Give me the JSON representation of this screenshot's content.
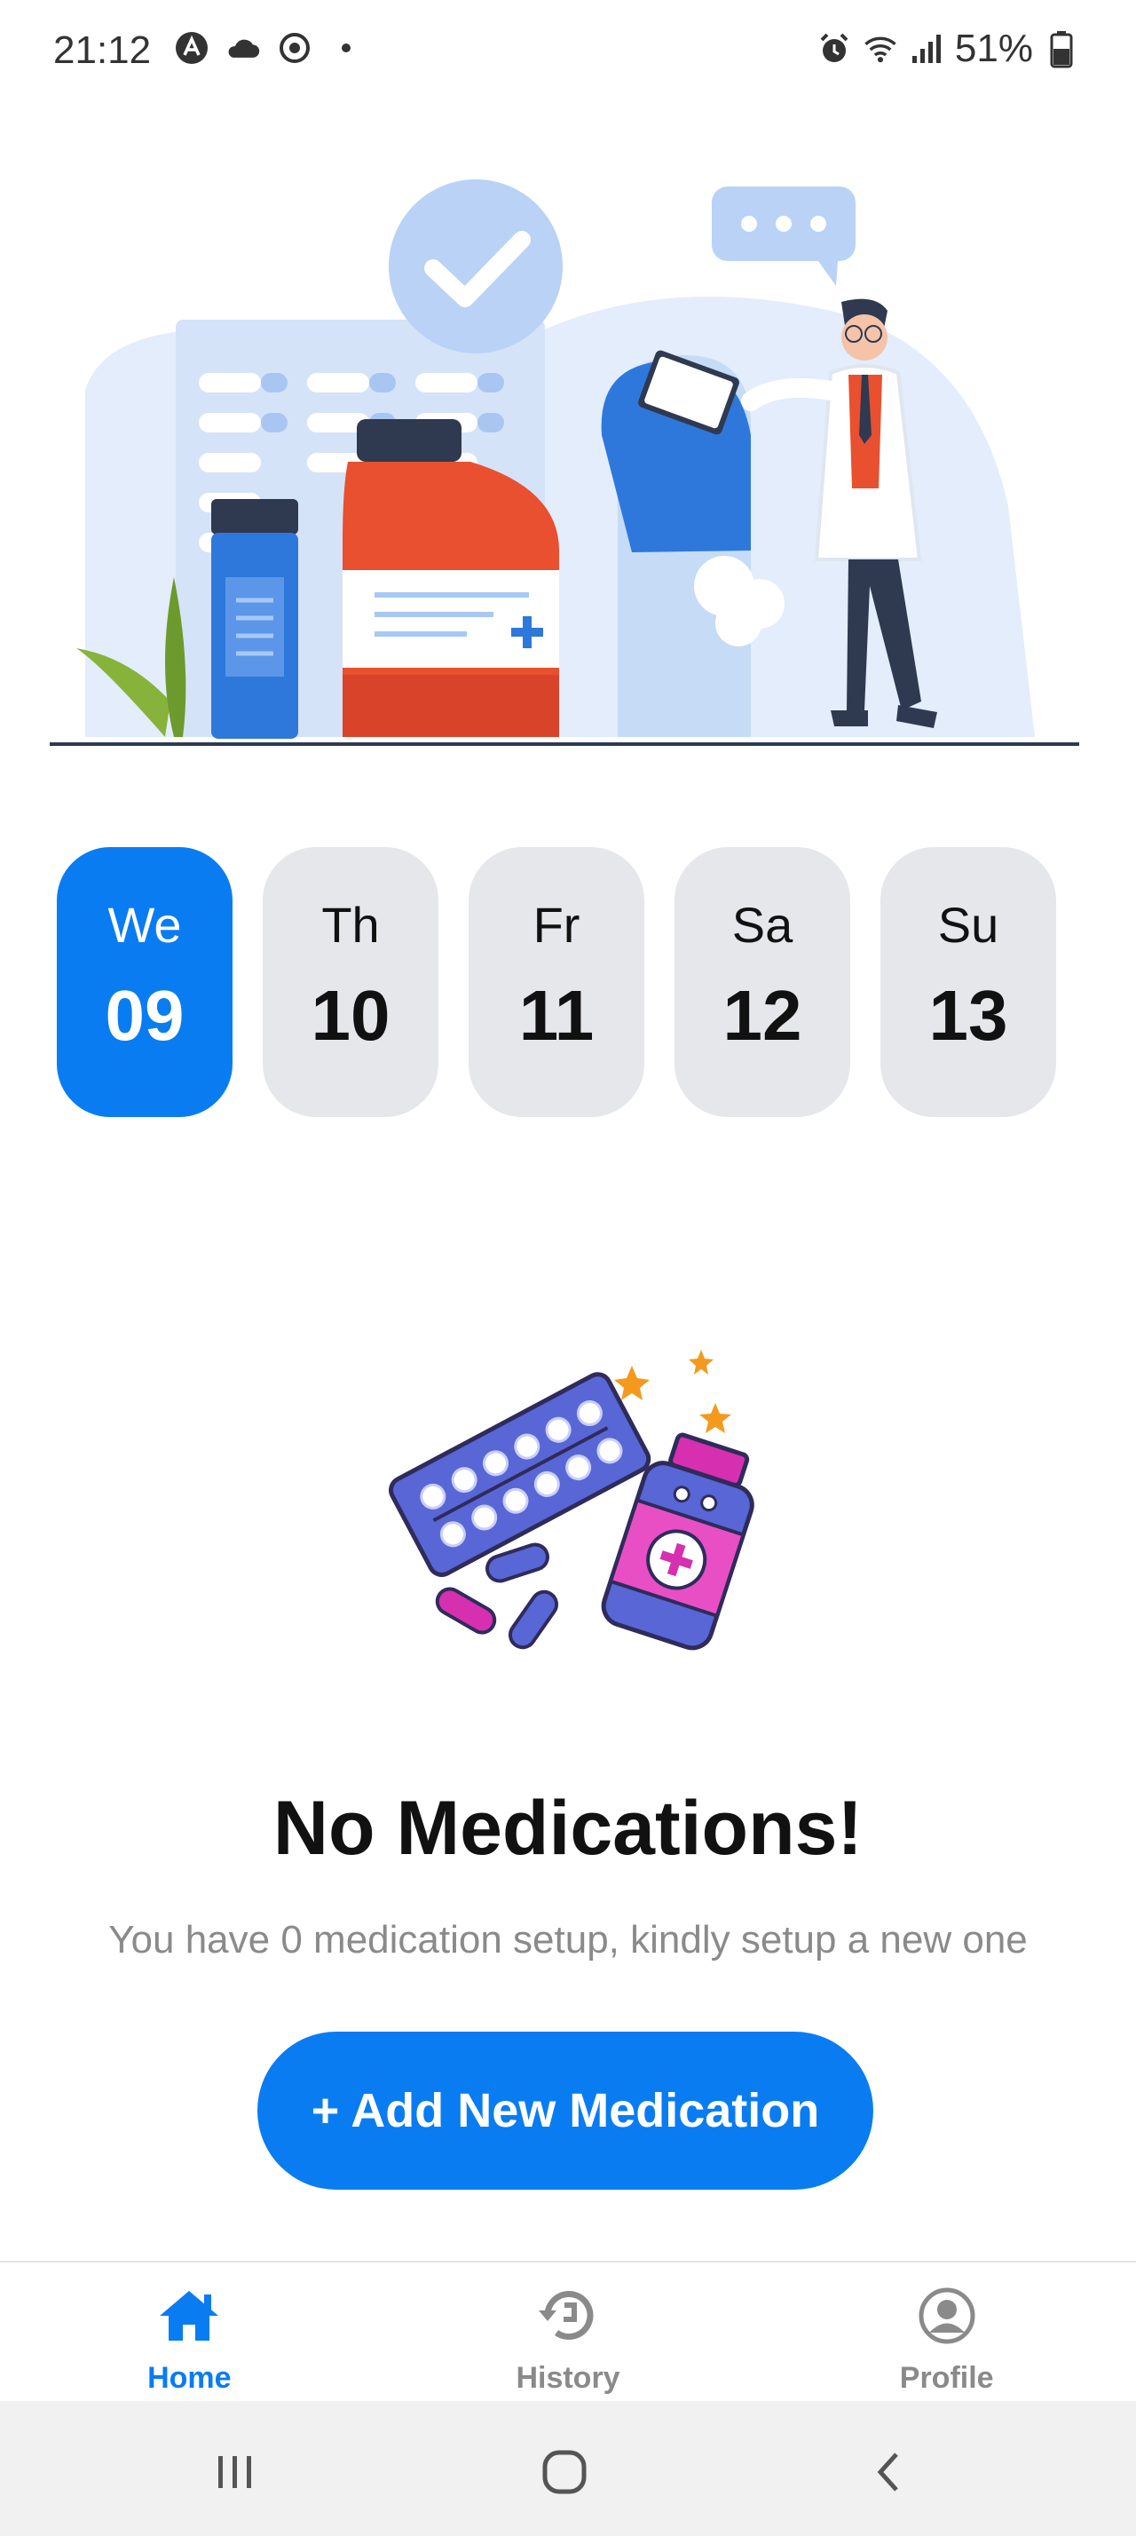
{
  "status_bar": {
    "time": "21:12",
    "battery": "51%"
  },
  "days": [
    {
      "name": "We",
      "number": "09",
      "selected": true
    },
    {
      "name": "Th",
      "number": "10",
      "selected": false
    },
    {
      "name": "Fr",
      "number": "11",
      "selected": false
    },
    {
      "name": "Sa",
      "number": "12",
      "selected": false
    },
    {
      "name": "Su",
      "number": "13",
      "selected": false
    }
  ],
  "empty_state": {
    "title": "No Medications!",
    "subtitle": "You have 0 medication setup, kindly setup a new one",
    "button_label": "+ Add New Medication"
  },
  "bottom_nav": {
    "items": [
      {
        "label": "Home",
        "icon": "home-icon",
        "active": true
      },
      {
        "label": "History",
        "icon": "history-icon",
        "active": false
      },
      {
        "label": "Profile",
        "icon": "profile-icon",
        "active": false
      }
    ]
  },
  "colors": {
    "accent": "#0a7cf2",
    "day_inactive_bg": "#e6e7ea",
    "subtitle_text": "#8a8a8a"
  }
}
